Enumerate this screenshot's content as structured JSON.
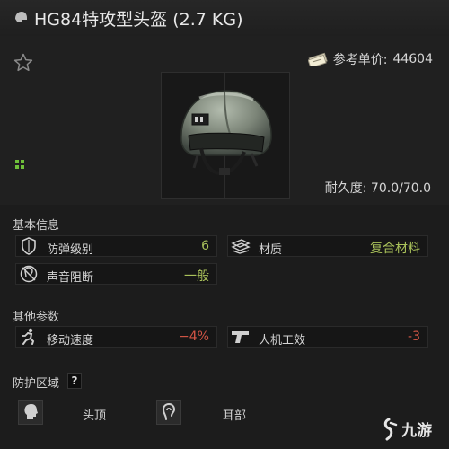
{
  "title": "HG84特攻型头盔 (2.7 KG)",
  "price": {
    "label": "参考单价:",
    "value": "44604"
  },
  "durability": "耐久度: 70.0/70.0",
  "sections": {
    "basic": {
      "title": "基本信息",
      "stats": [
        {
          "label": "防弹级别",
          "value": "6",
          "color": "#a9c15a",
          "icon": "shield-icon"
        },
        {
          "label": "材质",
          "value": "复合材料",
          "color": "#a9c15a",
          "icon": "material-icon"
        },
        {
          "label": "声音阻断",
          "value": "一般",
          "color": "#a9c15a",
          "icon": "ear-block-icon"
        }
      ]
    },
    "other": {
      "title": "其他参数",
      "stats": [
        {
          "label": "移动速度",
          "value": "−4%",
          "color": "#d25545",
          "icon": "running-icon"
        },
        {
          "label": "人机工效",
          "value": "-3",
          "color": "#d25545",
          "icon": "pistol-icon"
        }
      ]
    },
    "protection": {
      "title": "防护区域",
      "help": "?",
      "zones": [
        {
          "label": "头顶",
          "icon": "head-icon"
        },
        {
          "label": "耳部",
          "icon": "ear-icon"
        }
      ]
    }
  },
  "colors": {
    "positive": "#a9c15a",
    "negative": "#d25545",
    "accent_green": "#6fbf3a"
  },
  "watermark": "九游"
}
